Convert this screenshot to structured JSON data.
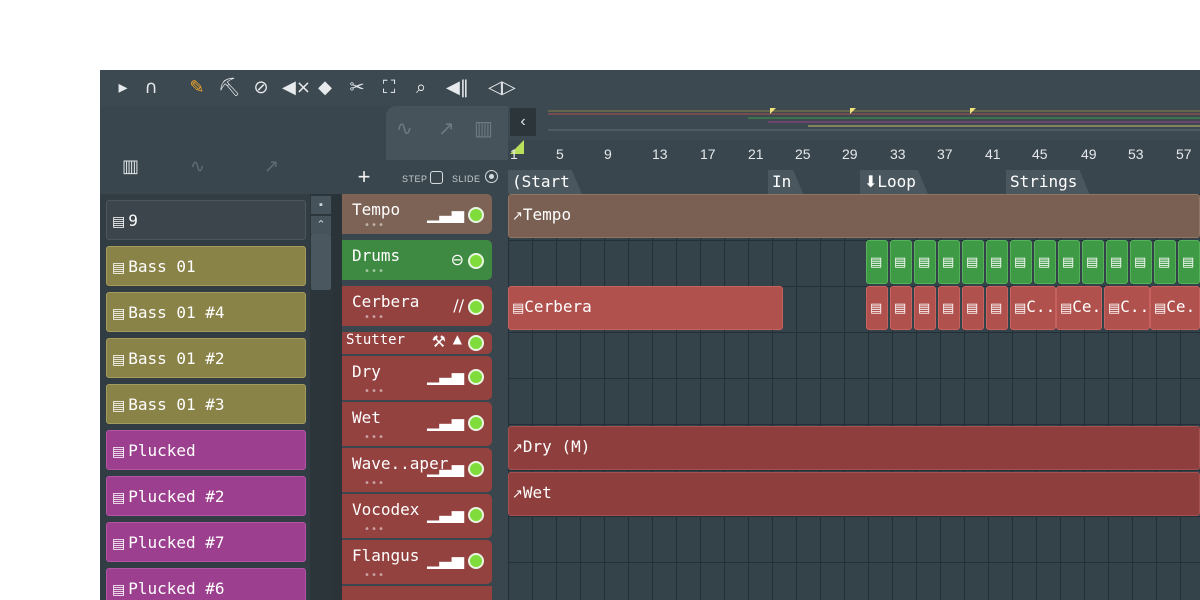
{
  "toolbar": {
    "icons": [
      "play-arrow-icon",
      "magnet-icon",
      "pencil-icon",
      "paint-bucket-icon",
      "delete-icon",
      "mute-icon",
      "slip-icon",
      "slice-icon",
      "select-icon",
      "zoom-icon",
      "playback-icon",
      "audio-icon"
    ]
  },
  "picker": {
    "patterns": [
      {
        "label": "9",
        "color": "grey"
      },
      {
        "label": "Bass 01",
        "color": "olive"
      },
      {
        "label": "Bass 01 #4",
        "color": "olive"
      },
      {
        "label": "Bass 01 #2",
        "color": "olive"
      },
      {
        "label": "Bass 01 #3",
        "color": "olive"
      },
      {
        "label": "Plucked",
        "color": "magenta"
      },
      {
        "label": "Plucked #2",
        "color": "magenta"
      },
      {
        "label": "Plucked #7",
        "color": "magenta"
      },
      {
        "label": "Plucked #6",
        "color": "magenta"
      }
    ]
  },
  "track_header": {
    "add": "+",
    "step_label": "STEP",
    "slide_label": "SLIDE"
  },
  "tracks": [
    {
      "name": "Tempo",
      "color": "brown",
      "icon": "level-bars-icon"
    },
    {
      "name": "Drums",
      "color": "green",
      "icon": "drum-icon"
    },
    {
      "name": "Cerbera",
      "color": "red",
      "icon": "automation-curve-icon"
    },
    {
      "name": "Stutter",
      "color": "red",
      "icon": "wrench-icon"
    },
    {
      "name": "Dry",
      "color": "red",
      "icon": "level-bars-icon"
    },
    {
      "name": "Wet",
      "color": "red",
      "icon": "level-bars-icon"
    },
    {
      "name": "Wave..aper",
      "color": "red",
      "icon": "level-bars-icon"
    },
    {
      "name": "Vocodex",
      "color": "red",
      "icon": "level-bars-icon"
    },
    {
      "name": "Flangus",
      "color": "red",
      "icon": "level-bars-icon"
    }
  ],
  "ruler": {
    "bars": [
      "1",
      "5",
      "9",
      "13",
      "17",
      "21",
      "25",
      "29",
      "33",
      "37",
      "41",
      "45",
      "49",
      "53",
      "57"
    ],
    "markers": [
      "(Start",
      "In",
      "Loop",
      "Strings"
    ]
  },
  "clips": {
    "tempo": "Tempo",
    "cerbera": "Cerbera",
    "dry": "Dry (M)",
    "wet": "Wet",
    "cerbera_short_1": "C..",
    "cerbera_short_2": "Ce..",
    "cerbera_short_3": "C..",
    "cerbera_short_4": "Ce.."
  },
  "colors": {
    "background": "#3a464d",
    "olive": "#8a8348",
    "magenta": "#9b3f8e",
    "green": "#3f9a45",
    "red": "#b0514d",
    "led": "#7fdc3b",
    "accent": "#f0a42a"
  }
}
